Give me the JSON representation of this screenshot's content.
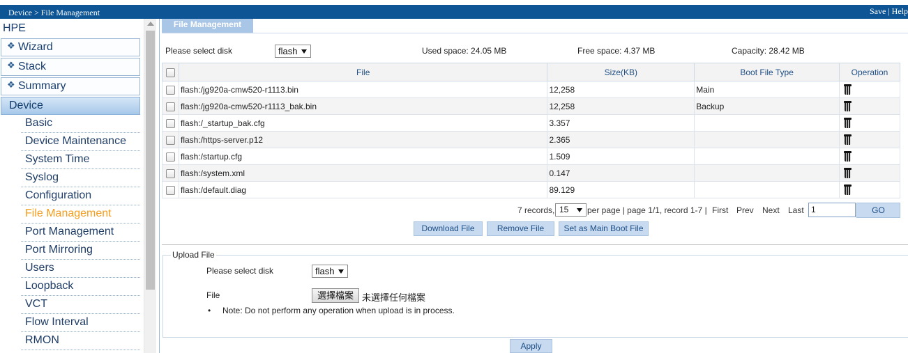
{
  "header": {
    "breadcrumb": "Device > File Management",
    "save": "Save",
    "separator": " | ",
    "help": "Help"
  },
  "sidebar": {
    "brand": "HPE",
    "top_items": [
      "Wizard",
      "Stack",
      "Summary"
    ],
    "section": "Device",
    "sub_items": [
      "Basic",
      "Device Maintenance",
      "System Time",
      "Syslog",
      "Configuration",
      "File Management",
      "Port Management",
      "Port Mirroring",
      "Users",
      "Loopback",
      "VCT",
      "Flow Interval",
      "RMON"
    ],
    "active_item": "File Management"
  },
  "main": {
    "tab_title": "File Management",
    "disk_label": "Please select disk",
    "disk_value": "flash",
    "used_space": "Used space: 24.05 MB",
    "free_space": "Free space: 4.37 MB",
    "capacity": "Capacity: 28.42 MB",
    "table": {
      "headers": [
        "File",
        "Size(KB)",
        "Boot File Type",
        "Operation"
      ],
      "rows": [
        {
          "file": "flash:/jg920a-cmw520-r1113.bin",
          "size": "12,258",
          "boot": "Main"
        },
        {
          "file": "flash:/jg920a-cmw520-r1113_bak.bin",
          "size": "12,258",
          "boot": "Backup"
        },
        {
          "file": "flash:/_startup_bak.cfg",
          "size": "3.357",
          "boot": ""
        },
        {
          "file": "flash:/https-server.p12",
          "size": "2.365",
          "boot": ""
        },
        {
          "file": "flash:/startup.cfg",
          "size": "1.509",
          "boot": ""
        },
        {
          "file": "flash:/system.xml",
          "size": "0.147",
          "boot": ""
        },
        {
          "file": "flash:/default.diag",
          "size": "89.129",
          "boot": ""
        }
      ]
    },
    "pager": {
      "records": "7 records,",
      "per_page_value": "15",
      "summary": "per page | page 1/1, record 1-7 |",
      "first": "First",
      "prev": "Prev",
      "next": "Next",
      "last": "Last",
      "page_input": "1",
      "go": "GO"
    },
    "buttons": {
      "download": "Download File",
      "remove": "Remove File",
      "set_main": "Set as Main Boot File"
    }
  },
  "upload": {
    "legend": "Upload File",
    "disk_label": "Please select disk",
    "disk_value": "flash",
    "file_label": "File",
    "choose_button": "選擇檔案",
    "no_file": "未選擇任何檔案",
    "note": "Note: Do not perform any operation when upload is in process.",
    "apply": "Apply"
  }
}
